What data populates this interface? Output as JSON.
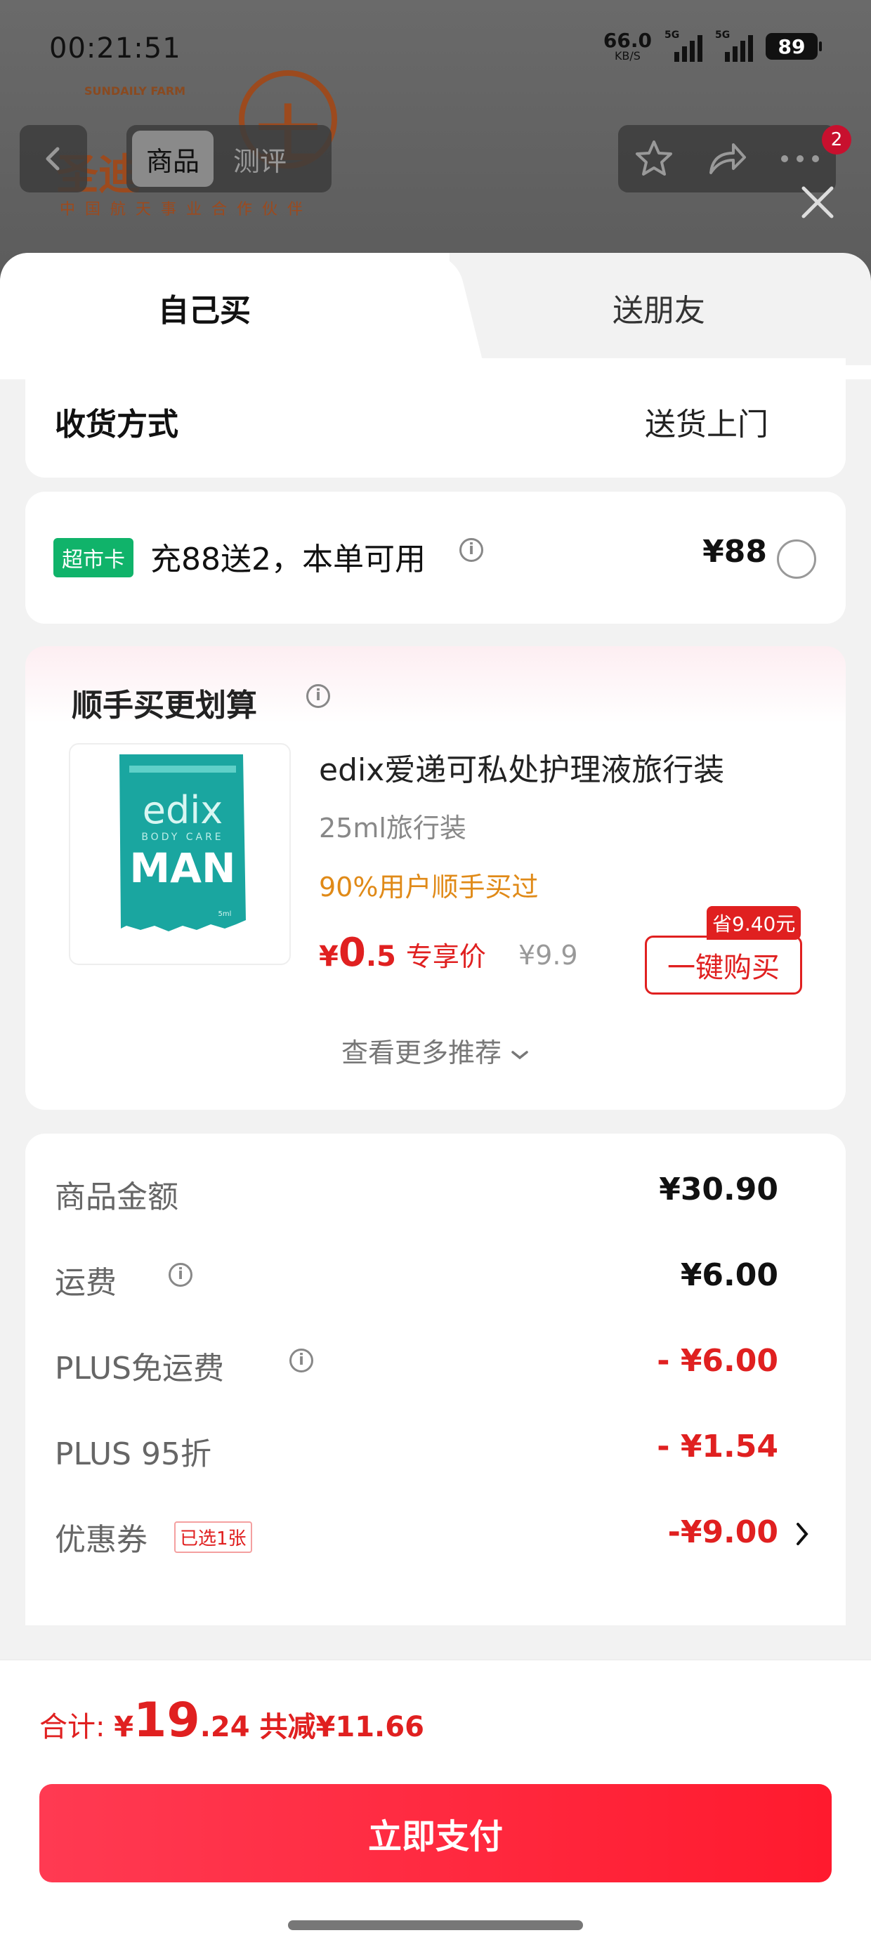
{
  "status_bar": {
    "time": "00:21:51",
    "net_speed": "66.0",
    "net_unit": "KB/S",
    "sig1": "5G",
    "sig2": "5G",
    "battery": "89"
  },
  "background": {
    "farm_text": "SUNDAILY FARM",
    "brand_text": "圣迪",
    "partner_text": "中国航天事业合作伙伴",
    "nav_tabs": [
      "商品",
      "测评"
    ],
    "badge_count": "2"
  },
  "sheet": {
    "tab_self": "自己买",
    "tab_friend": "送朋友"
  },
  "delivery": {
    "label": "收货方式",
    "value": "送货上门"
  },
  "promo": {
    "tag": "超市卡",
    "text": "充88送2，本单可用",
    "price": "¥88"
  },
  "addon": {
    "title": "顺手买更划算",
    "product_name": "edix爱递可私处护理液旅行装",
    "spec": "25ml旅行装",
    "social": "90%用户顺手买过",
    "price_currency": "¥",
    "price_main": "0",
    "price_decimal": ".5",
    "price_label": "专享价",
    "original_price": "¥9.9",
    "save_badge": "省9.40元",
    "buy_button": "一键购买",
    "see_more": "查看更多推荐"
  },
  "summary": {
    "goods_label": "商品金额",
    "goods_value": "¥30.90",
    "shipping_label": "运费",
    "shipping_value": "¥6.00",
    "plus_free_label": "PLUS免运费",
    "plus_free_value": "- ¥6.00",
    "plus_discount_label": "PLUS 95折",
    "plus_discount_value": "- ¥1.54",
    "coupon_label": "优惠券",
    "coupon_tag": "已选1张",
    "coupon_value": "-¥9.00"
  },
  "footer": {
    "total_label": "合计: ",
    "currency": "¥",
    "total_main": "19",
    "total_decimal": ".24",
    "total_saved": "共减¥11.66",
    "pay_button": "立即支付"
  },
  "colors": {
    "accent_red": "#e02020",
    "promo_green": "#10b36a",
    "social_orange": "#e08a18"
  },
  "icons": [
    "back-arrow-icon",
    "star-icon",
    "share-icon",
    "more-icon",
    "close-icon",
    "info-icon",
    "radio-icon",
    "chevron-down-icon",
    "chevron-right-icon"
  ]
}
